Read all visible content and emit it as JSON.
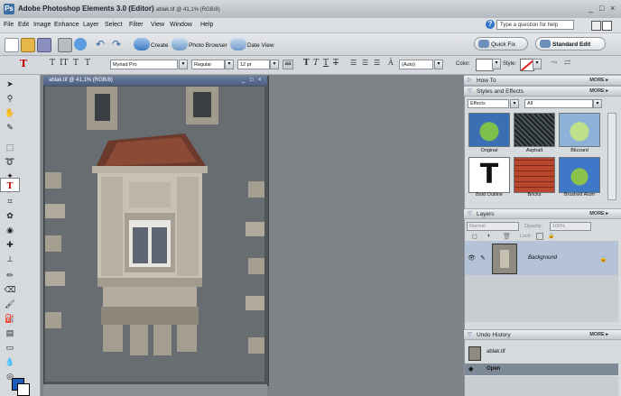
{
  "window": {
    "title": "Adobe Photoshop Elements 3.0 (Editor)",
    "doc_info": "ablak.tif @ 41,1% (RGB/8)",
    "controls": [
      "_",
      "□",
      "×"
    ]
  },
  "menu": [
    "File",
    "Edit",
    "Image",
    "Enhance",
    "Layer",
    "Select",
    "Filter",
    "View",
    "Window",
    "Help"
  ],
  "help": {
    "placeholder": "Type a question for help"
  },
  "shortcuts": {
    "create": "Create",
    "photo_browser": "Photo Browser",
    "date_view": "Date View",
    "quick_fix": "Quick Fix",
    "standard_edit": "Standard Edit"
  },
  "options": {
    "font_family": "Myriad Pro",
    "font_style": "Regular",
    "font_size": "12 pt",
    "aa": "aa",
    "leading": "(Auto)",
    "color_label": "Color:",
    "style_label": "Style:"
  },
  "document": {
    "title": "ablak.tif @ 41,1% (RGB/8)",
    "controls": [
      "_",
      "□",
      "×"
    ]
  },
  "panels": {
    "how_to": {
      "title": "How To",
      "more": "MORE ▸"
    },
    "styles": {
      "title": "Styles and Effects",
      "more": "MORE ▸",
      "category": "Effects",
      "filter": "All",
      "items": [
        "Original",
        "Asphalt",
        "Blizzard",
        "Bold Outline",
        "Bricks",
        "Brushed Alum"
      ]
    },
    "layers": {
      "title": "Layers",
      "more": "MORE ▸",
      "blend_mode": "Normal",
      "opacity_label": "Opacity:",
      "opacity": "100%",
      "lock_label": "Lock:",
      "layer_name": "Background"
    },
    "undo": {
      "title": "Undo History",
      "more": "MORE ▸",
      "items": [
        "ablak.tif",
        "Open"
      ]
    }
  },
  "colors": {
    "workspace": "#7d8386",
    "panel_bg": "#d8dbde",
    "selected_layer": "#b5c3d8",
    "accent_blue": "#3a67a6"
  }
}
